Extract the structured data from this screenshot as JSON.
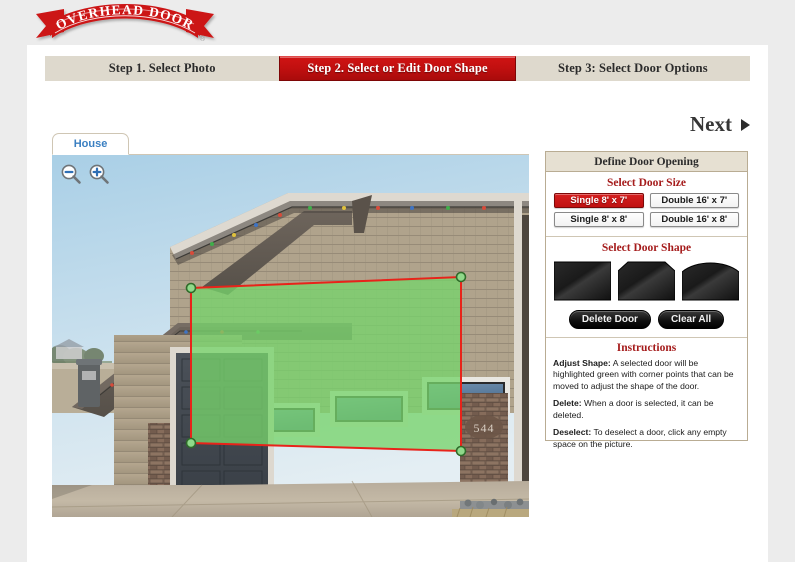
{
  "brand": {
    "name": "OVERHEAD DOOR",
    "logo_icon": "overhead-door-banner-logo",
    "registered_mark": "®",
    "red": "#cc1417"
  },
  "steps": [
    {
      "label": "Step 1. Select Photo",
      "active": false
    },
    {
      "label": "Step 2. Select or Edit Door Shape",
      "active": true
    },
    {
      "label": "Step 3: Select Door Options",
      "active": false
    }
  ],
  "next": {
    "label": "Next",
    "icon": "arrow-right-icon"
  },
  "photo_tabs": [
    {
      "label": "House",
      "active": true
    }
  ],
  "zoom_tools": [
    {
      "icon": "zoom-out-icon",
      "title": "Zoom Out"
    },
    {
      "icon": "zoom-in-icon",
      "title": "Zoom In"
    }
  ],
  "photo": {
    "alt": "Photo of a house with two garage doors; the large double door opening is selected and highlighted green",
    "house_number": "544",
    "selection": {
      "fill": "#77d36b",
      "outline": "#e8231a",
      "handle_fill": "#8fd98a",
      "handle_stroke": "#2f6b2a"
    }
  },
  "panel": {
    "header": "Define Door Opening",
    "size_section_title": "Select Door Size",
    "sizes": [
      {
        "label": "Single 8' x 7'",
        "selected": true
      },
      {
        "label": "Double 16' x 7'",
        "selected": false
      },
      {
        "label": "Single 8' x 8'",
        "selected": false
      },
      {
        "label": "Double 16' x 8'",
        "selected": false
      }
    ],
    "shape_section_title": "Select Door Shape",
    "shapes": [
      {
        "name": "door-shape-rectangle-icon"
      },
      {
        "name": "door-shape-chamfered-icon"
      },
      {
        "name": "door-shape-arched-icon"
      }
    ],
    "actions": [
      {
        "label": "Delete Door"
      },
      {
        "label": "Clear All"
      }
    ],
    "instructions_title": "Instructions",
    "instructions": [
      {
        "term": "Adjust Shape:",
        "text": "  A selected door will be highlighted green with corner points that can be moved to adjust the shape of the door."
      },
      {
        "term": "Delete:",
        "text": "  When a door is selected, it can be deleted."
      },
      {
        "term": "Deselect:",
        "text": "  To deselect a door, click any empty space on the picture."
      }
    ]
  }
}
